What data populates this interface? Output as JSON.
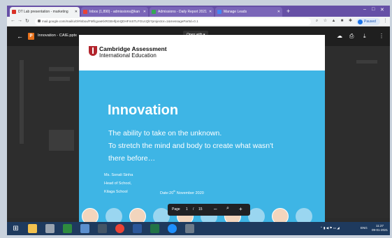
{
  "tabs": [
    {
      "title": "DT Lab presentation - marketing",
      "active": true,
      "color": "#d93025"
    },
    {
      "title": "Inbox (1,890) - admissions@kan",
      "active": false,
      "color": "#ea4335"
    },
    {
      "title": "Admissions - Daily Report 2021",
      "active": false,
      "color": "#34a853"
    },
    {
      "title": "Manage Leads",
      "active": false,
      "color": "#4285f4"
    }
  ],
  "address": {
    "url": "mail.google.com/mail/u/0/#inbox/FMfcgxwKkRGBHfpmQDHFmSTLFGUcQb?projector=1&messagePartId=0.1",
    "profile_label": "Paused"
  },
  "viewer": {
    "file_name": "Innovation - CAIE.pptx",
    "open_with": "Open with"
  },
  "slide": {
    "brand_line1": "Cambridge Assessment",
    "brand_line2": "International Education",
    "title": "Innovation",
    "line1": "The ability to take on the unknown.",
    "line2": "To stretch the mind and body to create what wasn't",
    "line3": "there before…",
    "presenter": "Ms. Sonali Sinha",
    "role": "Head of School,",
    "school": "Kilaga School",
    "date_prefix": "Date:20",
    "date_sup": "th",
    "date_suffix": " November 2020"
  },
  "page_control": {
    "label": "Page",
    "current": "1",
    "separator": "/",
    "total": "15"
  },
  "taskbar": {
    "lang": "ENG",
    "time": "11:27",
    "date": "09-01-2021"
  },
  "colors": {
    "slide_bg": "#3eb5e5",
    "tabstrip": "#6650a6",
    "taskbar": "#1e3a5e"
  }
}
